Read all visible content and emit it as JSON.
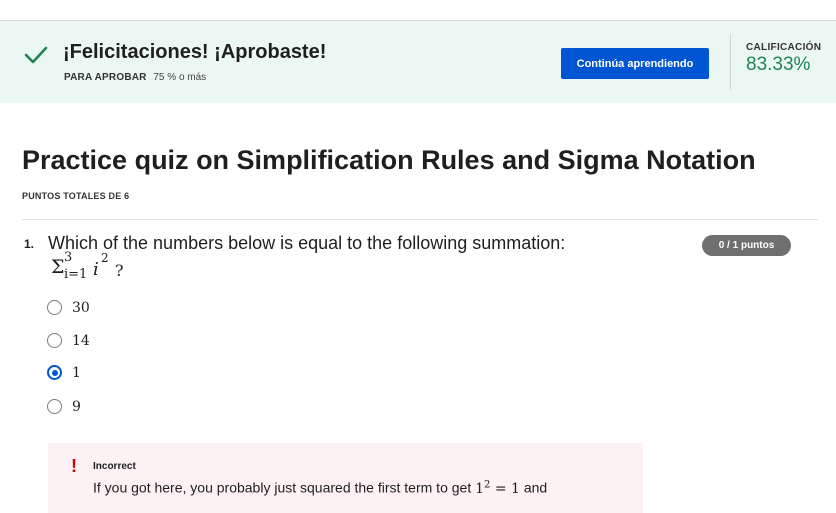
{
  "banner": {
    "message": "¡Felicitaciones! ¡Aprobaste!",
    "pass_label": "PARA APROBAR",
    "pass_requirement": "75 % o más",
    "continue_label": "Continúa aprendiendo",
    "grade_label": "CALIFICACIÓN",
    "grade_value": "83.33%",
    "icon": "checkmark-icon",
    "accent_color": "#1f8354"
  },
  "quiz": {
    "title": "Practice quiz on Simplification Rules and Sigma Notation",
    "total_points": "PUNTOS TOTALES DE 6"
  },
  "question": {
    "number": "1.",
    "text": "Which of the numbers below is equal to the following summation:",
    "formula": {
      "sigma": "Σ",
      "upper": "3",
      "lower": "i=1",
      "var": "i",
      "exponent": "2",
      "suffix": "?"
    },
    "points": "0 / 1 puntos",
    "options": [
      {
        "label": "30",
        "selected": false
      },
      {
        "label": "14",
        "selected": false
      },
      {
        "label": "1",
        "selected": true
      },
      {
        "label": "9",
        "selected": false
      }
    ]
  },
  "feedback": {
    "status": "Incorrect",
    "icon": "exclamation-icon",
    "text_before": "If you got here, you probably just squared the first term to get ",
    "math_base": "1",
    "math_exp": "2",
    "math_rest": " = 1",
    "text_after": " and",
    "color": "#d30000"
  }
}
